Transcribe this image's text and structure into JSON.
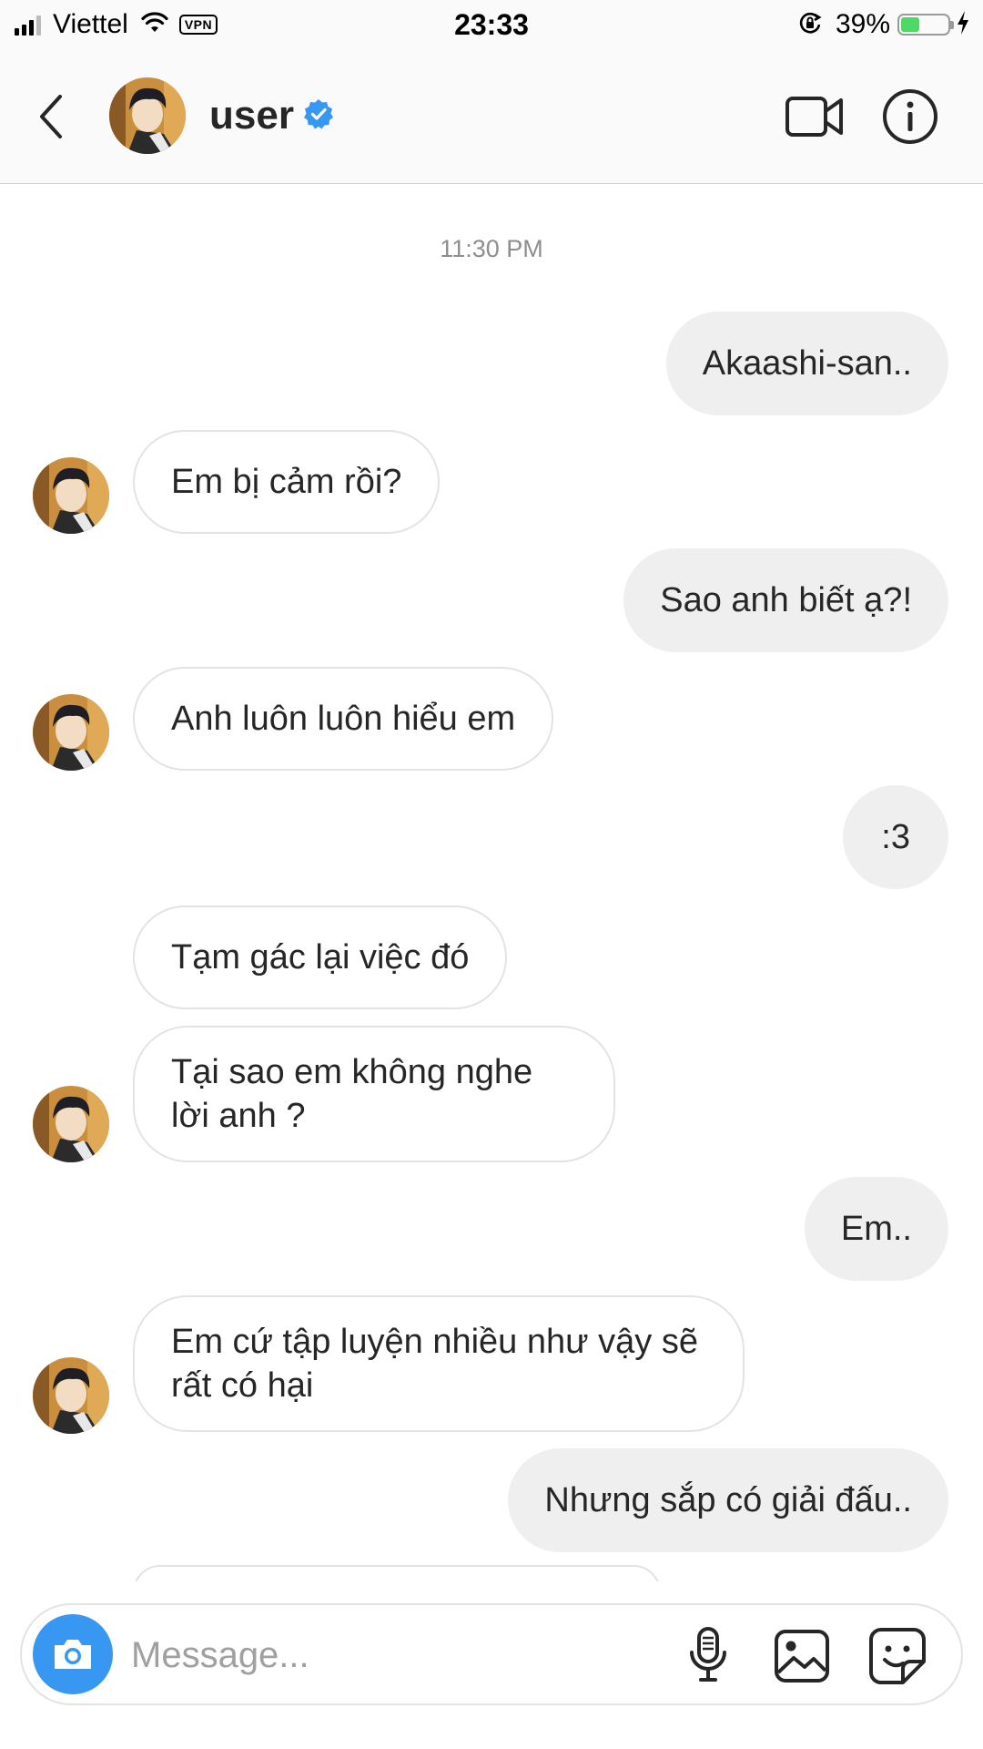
{
  "status_bar": {
    "carrier": "Viettel",
    "vpn": "VPN",
    "time": "23:33",
    "battery_percent": "39%",
    "battery_level": 0.39,
    "battery_color": "#4cd964"
  },
  "header": {
    "back_icon": "chevron-left-icon",
    "username": "user",
    "verified_icon": "verified-badge-icon",
    "verified_color": "#3897f0",
    "video_icon": "video-camera-icon",
    "info_icon": "info-icon"
  },
  "thread": {
    "timestamp": "11:30 PM",
    "messages": [
      {
        "from": "me",
        "text": "Akaashi-san.."
      },
      {
        "from": "user",
        "text": "Em bị cảm rồi?"
      },
      {
        "from": "me",
        "text": "Sao anh biết ạ?!"
      },
      {
        "from": "user",
        "text": "Anh luôn luôn hiểu em"
      },
      {
        "from": "me",
        "text": ":3"
      },
      {
        "from": "user",
        "text": "Tạm gác lại việc đó"
      },
      {
        "from": "user",
        "text": "Tại sao em không nghe lời anh ?"
      },
      {
        "from": "me",
        "text": "Em.."
      },
      {
        "from": "user",
        "text": "Em cứ tập luyện nhiều như vậy sẽ rất có hại"
      },
      {
        "from": "me",
        "text": "Nhưng sắp có giải đấu.."
      }
    ]
  },
  "composer": {
    "placeholder": "Message...",
    "camera_icon": "camera-icon",
    "camera_color": "#3897f0",
    "mic_icon": "microphone-icon",
    "gallery_icon": "gallery-icon",
    "sticker_icon": "sticker-icon"
  }
}
